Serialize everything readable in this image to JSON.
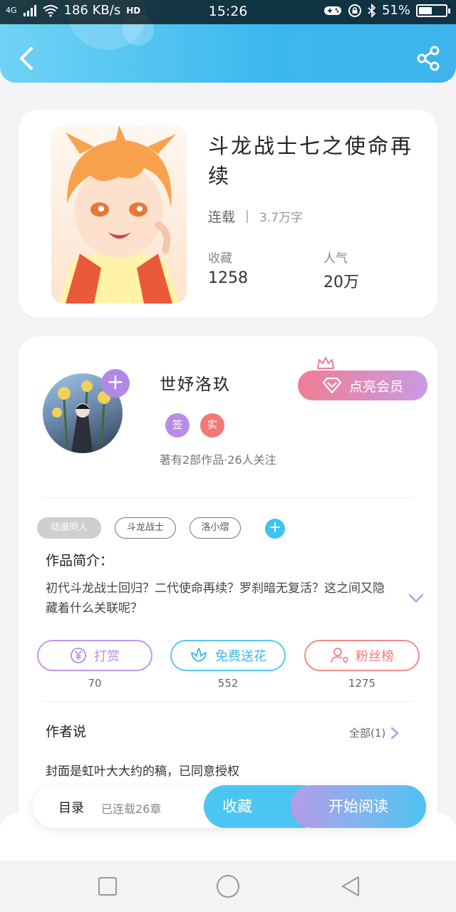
{
  "status_bar": {
    "network": "4G",
    "speed": "186 KB/s",
    "hd": "HD",
    "time": "15:26",
    "battery": "51%",
    "battery_level": 0.51
  },
  "book": {
    "title": "斗龙战士七之使命再续",
    "status": "连载",
    "word_count": "3.7万字",
    "favorites_label": "收藏",
    "favorites_value": "1258",
    "popularity_label": "人气",
    "popularity_value": "20万"
  },
  "author": {
    "name": "世妤洛玖",
    "follow_symbol": "+",
    "badge_sign": "签",
    "badge_real": "实",
    "meta": "著有2部作品·26人关注",
    "vip_label": "点亮会员"
  },
  "tags": [
    "动漫同人",
    "斗龙战士",
    "洛小熠"
  ],
  "tag_add_symbol": "+",
  "intro": {
    "title": "作品简介：",
    "text": "初代斗龙战士回归？二代使命再续？罗刹暗无复活？这之间又隐藏着什么关联呢？"
  },
  "actions": [
    {
      "label": "打赏",
      "count": "70",
      "icon": "yen-coin-icon"
    },
    {
      "label": "免费送花",
      "count": "552",
      "icon": "flower-icon"
    },
    {
      "label": "粉丝榜",
      "count": "1275",
      "icon": "fan-user-icon"
    }
  ],
  "author_say": {
    "title": "作者说",
    "all_label": "全部(1)",
    "text": "封面是虹叶大大约的稿，已同意授权"
  },
  "bottom_bar": {
    "toc_label": "目录",
    "chapters_label": "已连载26章",
    "favorite_label": "收藏",
    "read_label": "开始阅读"
  },
  "colors": {
    "header_gradient": [
      "#6fd3f5",
      "#3ab8ee"
    ],
    "purple": "#b89ae6",
    "pink": "#f07d93",
    "cyan": "#3cc3ef",
    "red": "#f08c8c"
  }
}
